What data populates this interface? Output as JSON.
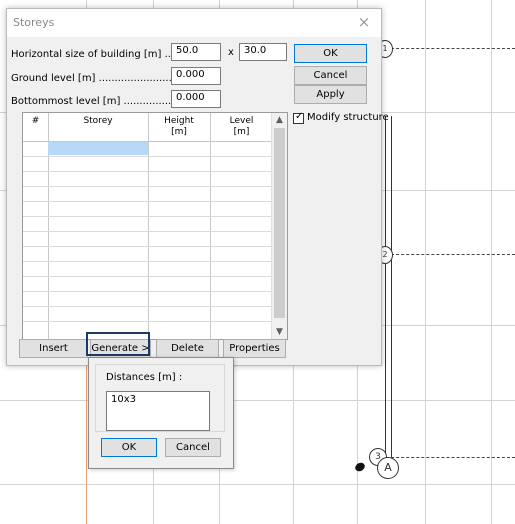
{
  "dialog": {
    "title": "Storeys",
    "close_label": "×",
    "fields": {
      "horizontal_label": "Horizontal size of building [m] ............",
      "horizontal_x": "50.0",
      "x_separator": "x",
      "horizontal_y": "30.0",
      "ground_label": "Ground level [m] ...........................",
      "ground_value": "0.000",
      "bottom_label": "Bottommost level [m] ......................",
      "bottom_value": "0.000"
    },
    "buttons": {
      "ok": "OK",
      "cancel": "Cancel",
      "apply": "Apply",
      "insert": "Insert",
      "generate": "Generate >",
      "delete": "Delete",
      "properties": "Properties"
    },
    "modify_structure": {
      "label": "Modify structure",
      "checked": true
    },
    "table": {
      "headers": [
        "#",
        "Storey",
        "Height\n[m]",
        "Level\n[m]"
      ],
      "rows": []
    }
  },
  "popup": {
    "label": "Distances [m] :",
    "value": "10x3",
    "ok": "OK",
    "cancel": "Cancel"
  },
  "drawing": {
    "axis_labels": [
      "1",
      "2",
      "3",
      "A"
    ]
  },
  "colors": {
    "accent": "#0078d7",
    "selection": "#b7d8f7",
    "highlight_box": "#1a3b66"
  }
}
